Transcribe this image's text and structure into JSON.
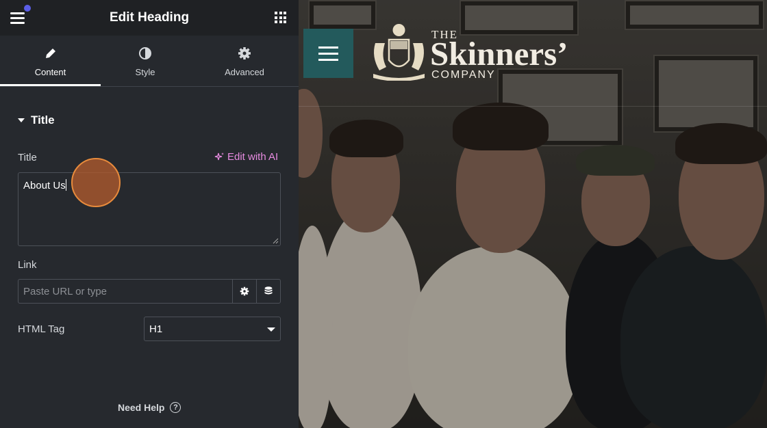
{
  "header": {
    "title": "Edit Heading"
  },
  "tabs": [
    {
      "label": "Content",
      "icon": "pencil-icon",
      "active": true
    },
    {
      "label": "Style",
      "icon": "contrast-icon",
      "active": false
    },
    {
      "label": "Advanced",
      "icon": "gear-icon",
      "active": false
    }
  ],
  "section": {
    "title": "Title"
  },
  "fields": {
    "title": {
      "label": "Title",
      "value": "About Us",
      "ai_label": "Edit with AI"
    },
    "link": {
      "label": "Link",
      "placeholder": "Paste URL or type"
    },
    "html_tag": {
      "label": "HTML Tag",
      "value": "H1"
    }
  },
  "help": {
    "label": "Need Help"
  },
  "preview": {
    "brand_the": "THE",
    "brand_name": "Skinners’",
    "brand_company": "COMPANY"
  },
  "colors": {
    "accent_ai": "#e78be0",
    "tile": "#235a5c",
    "panel": "#26292e",
    "topbar": "#1f2124"
  }
}
